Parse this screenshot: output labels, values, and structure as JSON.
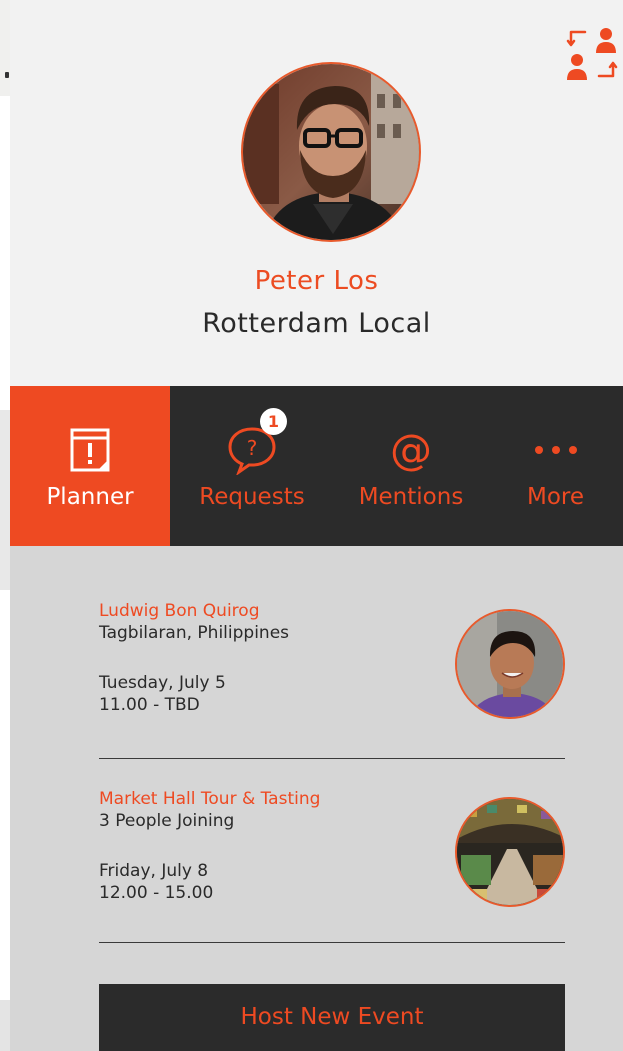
{
  "profile": {
    "name": "Peter Los",
    "role": "Rotterdam Local",
    "switch_icon": "switch-users-icon"
  },
  "tabs": [
    {
      "label": "Planner",
      "icon": "calendar-alert-icon",
      "active": true
    },
    {
      "label": "Requests",
      "icon": "question-bubble-icon",
      "badge": "1",
      "active": false
    },
    {
      "label": "Mentions",
      "icon": "at-sign-icon",
      "active": false
    },
    {
      "label": "More",
      "icon": "ellipsis-icon",
      "active": false
    }
  ],
  "events": [
    {
      "title": "Ludwig Bon Quirog",
      "subtitle": "Tagbilaran, Philippines",
      "date": "Tuesday, July 5",
      "time": "11.00 - TBD"
    },
    {
      "title": "Market Hall Tour & Tasting",
      "subtitle": "3 People Joining",
      "date": "Friday, July 8",
      "time": "12.00 - 15.00"
    }
  ],
  "actions": {
    "host_label": "Host New Event"
  },
  "colors": {
    "accent": "#ee4a22",
    "dark": "#2b2b2b",
    "header_bg": "#f2f2f2",
    "content_bg": "#d6d6d6"
  }
}
